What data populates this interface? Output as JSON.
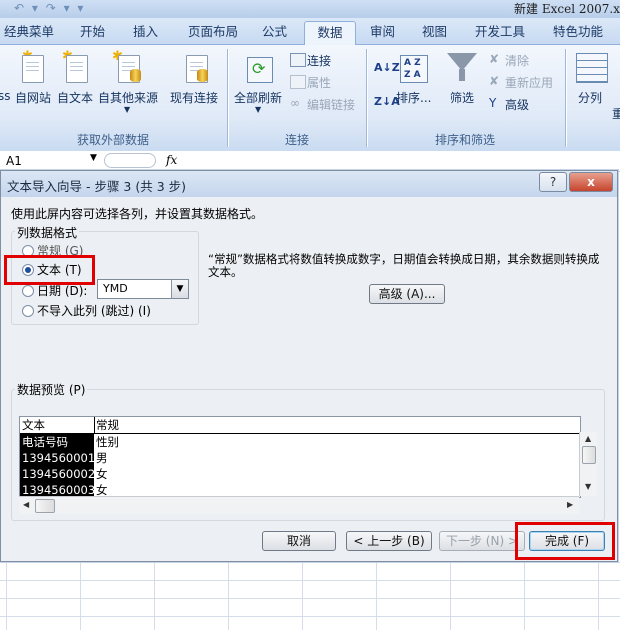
{
  "app": {
    "title": "新建 Excel 2007.x",
    "quick_access": "↶ ▾ ↷ ▾ ▾"
  },
  "tabs": [
    "经典菜单",
    "开始",
    "插入",
    "页面布局",
    "公式",
    "数据",
    "审阅",
    "视图",
    "开发工具",
    "特色功能"
  ],
  "active_tab": "数据",
  "ribbon": {
    "get_external_data": {
      "label": "获取外部数据",
      "buttons": [
        "ss",
        "自网站",
        "自文本",
        "自其他来源",
        "现有连接"
      ]
    },
    "connections": {
      "label": "连接",
      "refresh_all": "全部刷新",
      "connect": "连接",
      "properties": "属性",
      "edit_links": "编辑链接"
    },
    "sort_filter": {
      "label": "排序和筛选",
      "sort": "排序...",
      "filter": "筛选",
      "clear": "清除",
      "reapply": "重新应用",
      "advanced": "高级"
    },
    "data_tools": {
      "split": "分列",
      "more": "重"
    }
  },
  "formula_bar": {
    "name_box": "A1",
    "fx": "fx"
  },
  "dialog": {
    "title": "文本导入向导 - 步骤 3 (共 3 步)",
    "help_btn": "?",
    "close_btn": "x",
    "instruction": "使用此屏内容可选择各列，并设置其数据格式。",
    "column_format_label": "列数据格式",
    "options": {
      "general": "常规 (G)",
      "text": "文本 (T)",
      "date": "日期 (D):",
      "skip": "不导入此列 (跳过) (I)"
    },
    "selected_option": "text",
    "date_format": "YMD",
    "description": "“常规”数据格式将数值转换成数字，日期值会转换成日期，其余数据则转换成文本。",
    "advanced_btn": "高级 (A)...",
    "preview_label": "数据预览 (P)",
    "preview": {
      "headers": [
        "文本",
        "常规"
      ],
      "rows": [
        [
          "电话号码",
          "性别"
        ],
        [
          "1394560001",
          "男"
        ],
        [
          "1394560002",
          "女"
        ],
        [
          "1394560003",
          "女"
        ]
      ]
    },
    "buttons": {
      "cancel": "取消",
      "back": "< 上一步 (B)",
      "next": "下一步 (N) >",
      "finish": "完成 (F)"
    }
  },
  "highlight_color": "#e00000"
}
